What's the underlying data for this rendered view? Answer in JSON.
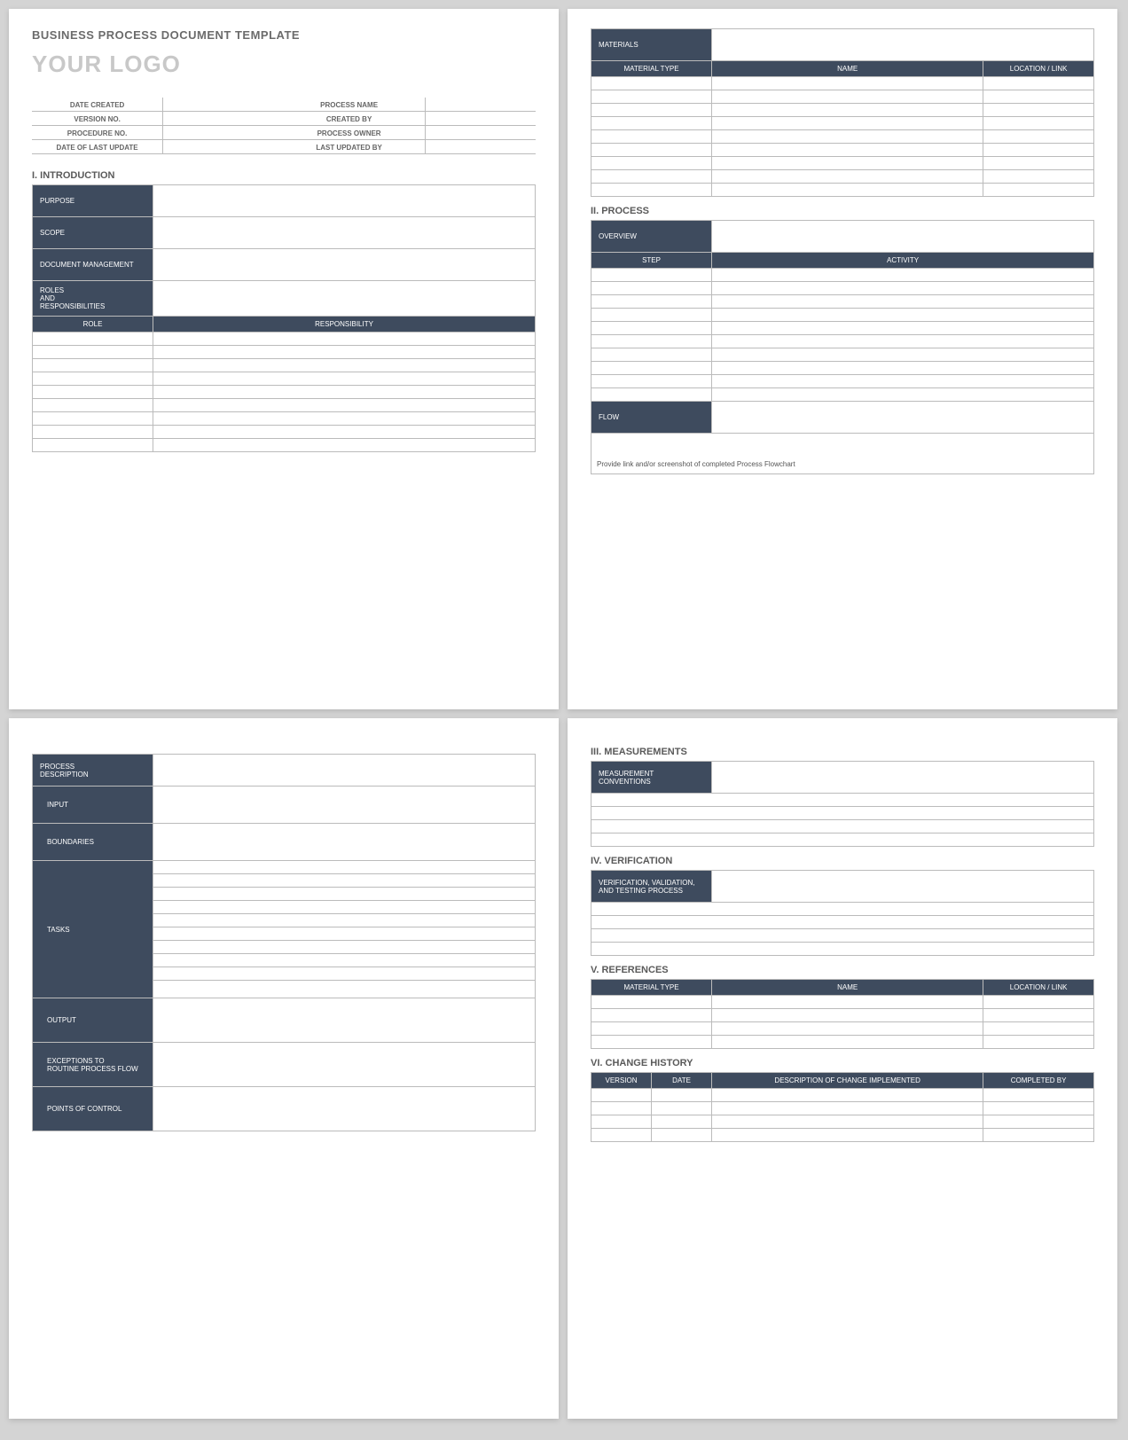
{
  "doc_title": "BUSINESS PROCESS DOCUMENT TEMPLATE",
  "logo": "YOUR LOGO",
  "meta": {
    "date_created": "DATE CREATED",
    "process_name": "PROCESS NAME",
    "version_no": "VERSION NO.",
    "created_by": "CREATED BY",
    "procedure_no": "PROCEDURE NO.",
    "process_owner": "PROCESS OWNER",
    "date_last_update": "DATE OF LAST UPDATE",
    "last_updated_by": "LAST UPDATED BY"
  },
  "sections": {
    "introduction": "I.   INTRODUCTION",
    "process": "II.   PROCESS",
    "measurements": "III.  MEASUREMENTS",
    "verification": "IV.  VERIFICATION",
    "references": "V.  REFERENCES",
    "change_history": "VI. CHANGE HISTORY"
  },
  "labels": {
    "purpose": "PURPOSE",
    "scope": "SCOPE",
    "document_management": "DOCUMENT MANAGEMENT",
    "roles_resp": "ROLES\nAND\nRESPONSIBILITIES",
    "role": "ROLE",
    "responsibility": "RESPONSIBILITY",
    "materials": "MATERIALS",
    "material_type": "MATERIAL TYPE",
    "name": "NAME",
    "location_link": "LOCATION / LINK",
    "overview": "OVERVIEW",
    "step": "STEP",
    "activity": "ACTIVITY",
    "flow": "FLOW",
    "flow_note": "Provide link and/or screenshot of completed Process Flowchart",
    "process_desc": "PROCESS\nDESCRIPTION",
    "input": "INPUT",
    "boundaries": "BOUNDARIES",
    "tasks": "TASKS",
    "output": "OUTPUT",
    "exceptions": "EXCEPTIONS TO\nROUTINE PROCESS FLOW",
    "points_control": "POINTS OF CONTROL",
    "measurement_conv": "MEASUREMENT\nCONVENTIONS",
    "verification_label": "VERIFICATION, VALIDATION,\nAND TESTING PROCESS",
    "version": "VERSION",
    "date": "DATE",
    "description_change": "DESCRIPTION OF CHANGE IMPLEMENTED",
    "completed_by": "COMPLETED BY"
  }
}
